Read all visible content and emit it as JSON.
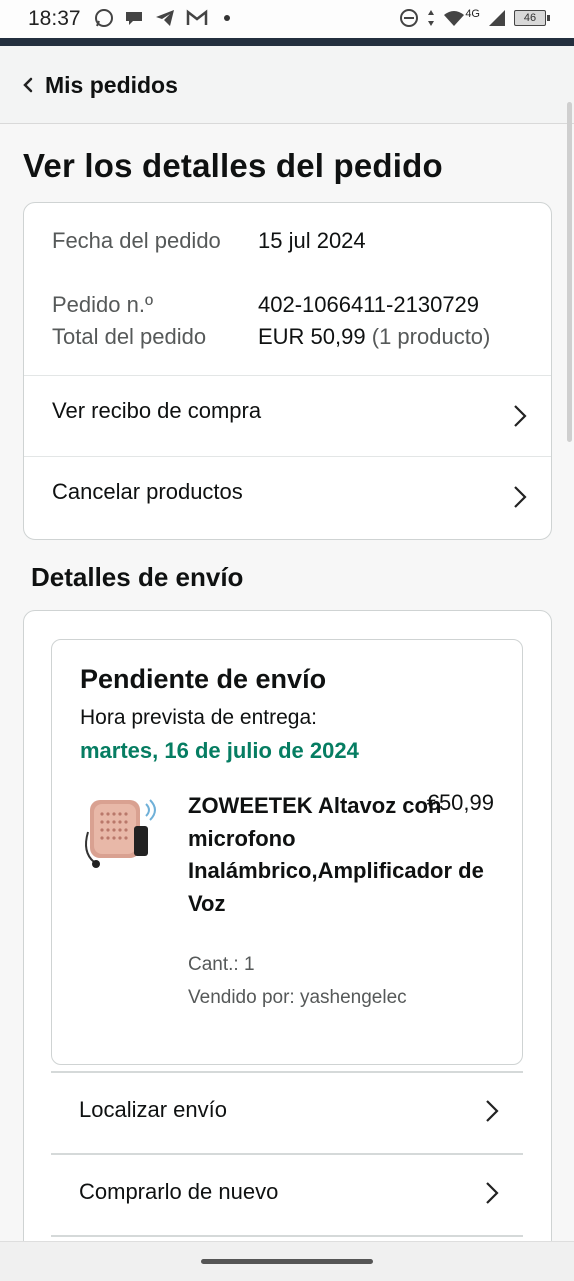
{
  "status_bar": {
    "time": "18:37",
    "network": "4G",
    "battery": "46",
    "left_icons": [
      "whatsapp-icon",
      "chat-icon",
      "telegram-icon",
      "gmail-icon",
      "dot-icon"
    ],
    "right_icons": [
      "do-not-disturb-icon",
      "data-arrows-icon",
      "wifi-icon",
      "signal-icon",
      "battery-icon"
    ]
  },
  "header": {
    "back_label": "Mis pedidos"
  },
  "page": {
    "title": "Ver los detalles del pedido"
  },
  "order_summary": {
    "date_label": "Fecha del pedido",
    "date_value": "15 jul 2024",
    "number_label": "Pedido n.º",
    "number_value": "402-1066411-2130729",
    "total_label": "Total del pedido",
    "total_value": "EUR 50,99",
    "total_count": "(1 producto)",
    "links": [
      {
        "label": "Ver recibo de compra"
      },
      {
        "label": "Cancelar productos"
      }
    ]
  },
  "shipping": {
    "section_title": "Detalles de envío",
    "status": "Pendiente de envío",
    "eta_label": "Hora prevista de entrega:",
    "eta_date": "martes, 16 de julio de 2024",
    "product": {
      "name": "ZOWEETEK Altavoz con microfono Inalámbrico,Amplificador de Voz",
      "price": "€50,99",
      "qty": "Cant.: 1",
      "seller": "Vendido por: yashengelec",
      "image": "speaker-product-image"
    },
    "links": [
      {
        "label": "Localizar envío"
      },
      {
        "label": "Comprarlo de nuevo"
      }
    ]
  },
  "colors": {
    "accent_green": "#067d62",
    "header_bar": "#232f3e"
  }
}
